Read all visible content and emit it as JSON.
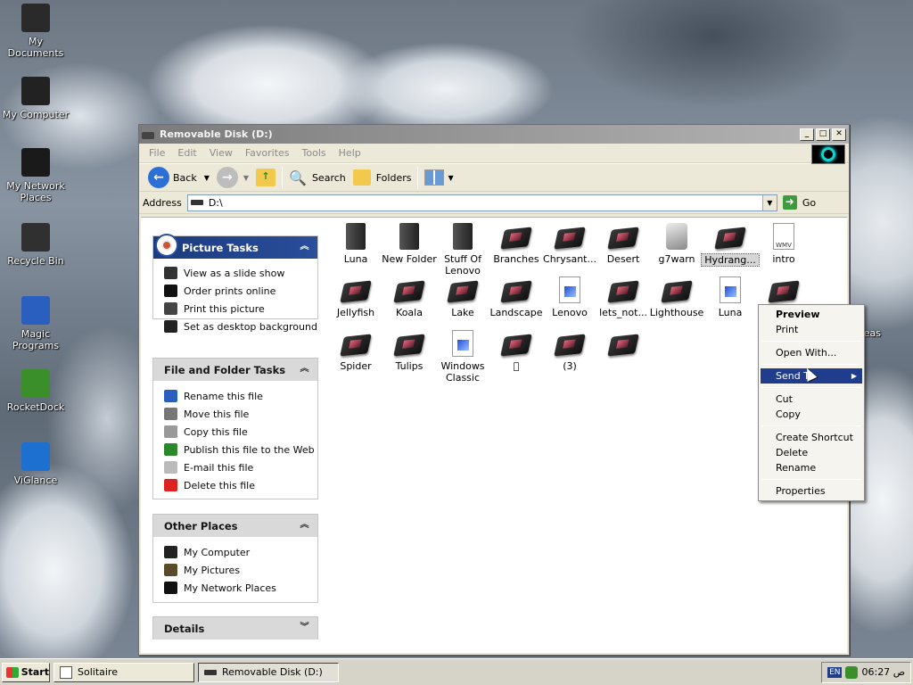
{
  "desktop": {
    "icons": [
      {
        "label": "My Documents",
        "color": "#2a2a2a"
      },
      {
        "label": "My Computer",
        "color": "#222"
      },
      {
        "label": "My Network Places",
        "color": "#1a1a1a"
      },
      {
        "label": "Recycle Bin",
        "color": "#303030"
      },
      {
        "label": "Magic Programs",
        "color": "#2b5fbf"
      },
      {
        "label": "RocketDock",
        "color": "#3a8f2a"
      },
      {
        "label": "ViGlance",
        "color": "#1d6fd0"
      }
    ],
    "partial_label": "angeas"
  },
  "window": {
    "title": "Removable Disk (D:)",
    "menu": [
      "File",
      "Edit",
      "View",
      "Favorites",
      "Tools",
      "Help"
    ],
    "toolbar": {
      "back": "Back",
      "search": "Search",
      "folders": "Folders"
    },
    "address": {
      "label": "Address",
      "value": "D:\\",
      "go": "Go"
    }
  },
  "tasks": {
    "picture": {
      "title": "Picture Tasks",
      "items": [
        {
          "label": "View as a slide show",
          "icon": "slideshow-icon",
          "color": "#333"
        },
        {
          "label": "Order prints online",
          "icon": "order-icon",
          "color": "#111"
        },
        {
          "label": "Print this picture",
          "icon": "printer-icon",
          "color": "#444"
        },
        {
          "label": "Set as desktop background",
          "icon": "desktop-icon",
          "color": "#222"
        }
      ]
    },
    "filefolder": {
      "title": "File and Folder Tasks",
      "items": [
        {
          "label": "Rename this file",
          "icon": "rename-icon",
          "color": "#2b5fbf"
        },
        {
          "label": "Move this file",
          "icon": "move-icon",
          "color": "#777"
        },
        {
          "label": "Copy this file",
          "icon": "copy-icon",
          "color": "#999"
        },
        {
          "label": "Publish this file to the Web",
          "icon": "globe-icon",
          "color": "#2a8a2a"
        },
        {
          "label": "E-mail this file",
          "icon": "email-icon",
          "color": "#bbb"
        },
        {
          "label": "Delete this file",
          "icon": "delete-icon",
          "color": "#d22"
        }
      ]
    },
    "other": {
      "title": "Other Places",
      "items": [
        {
          "label": "My Computer",
          "icon": "computer-icon",
          "color": "#222"
        },
        {
          "label": "My Pictures",
          "icon": "pictures-icon",
          "color": "#5a4a2a"
        },
        {
          "label": "My Network Places",
          "icon": "network-icon",
          "color": "#111"
        }
      ]
    },
    "details": {
      "title": "Details"
    }
  },
  "files": [
    {
      "label": "Luna",
      "type": "folder"
    },
    {
      "label": "New Folder",
      "type": "folder"
    },
    {
      "label": "Stuff Of Lenovo",
      "type": "folder"
    },
    {
      "label": "Branches",
      "type": "img"
    },
    {
      "label": "Chrysant...",
      "type": "img"
    },
    {
      "label": "Desert",
      "type": "img"
    },
    {
      "label": "g7warn",
      "type": "exe"
    },
    {
      "label": "Hydrang...",
      "type": "img"
    },
    {
      "label": "intro",
      "type": "wmv"
    },
    {
      "label": "Jellyfish",
      "type": "img"
    },
    {
      "label": "Koala",
      "type": "img"
    },
    {
      "label": "Lake",
      "type": "img"
    },
    {
      "label": "Landscape",
      "type": "img"
    },
    {
      "label": "Lenovo",
      "type": "bmp"
    },
    {
      "label": "lets_not...",
      "type": "img"
    },
    {
      "label": "Lighthouse",
      "type": "img"
    },
    {
      "label": "Luna",
      "type": "bmp"
    },
    {
      "label": "",
      "type": "img"
    },
    {
      "label": "Spider",
      "type": "img"
    },
    {
      "label": "Tulips",
      "type": "img"
    },
    {
      "label": "Windows Classic",
      "type": "bmp"
    },
    {
      "label": "\u0000",
      "type": "img"
    },
    {
      "label": "(3)",
      "type": "img"
    },
    {
      "label": "",
      "type": "img"
    }
  ],
  "context_menu": {
    "items": [
      "Preview",
      "Print",
      "Open With...",
      "Send To",
      "Cut",
      "Copy",
      "Create Shortcut",
      "Delete",
      "Rename",
      "Properties"
    ]
  },
  "taskbar": {
    "start": "Start",
    "tasks": [
      "Solitaire",
      "Removable Disk (D:)"
    ],
    "lang": "EN",
    "clock": "06:27 ص"
  }
}
